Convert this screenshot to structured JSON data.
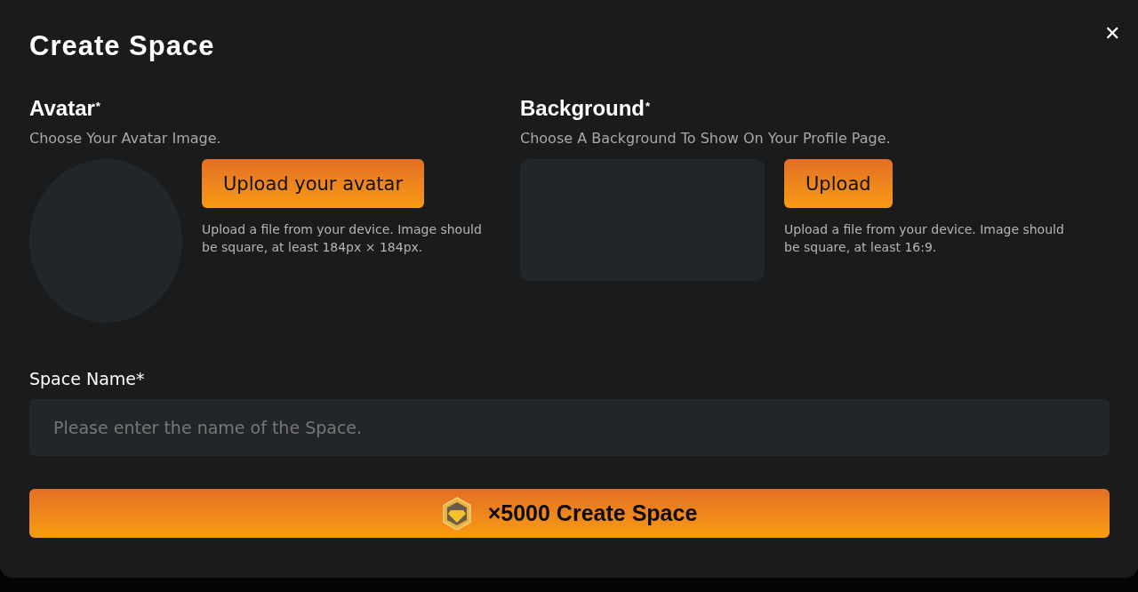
{
  "dialog": {
    "title": "Create Space",
    "close": "✕"
  },
  "uploads": [
    {
      "kind": "avatar",
      "label": "Avatar",
      "mark": "*",
      "hint": "Choose Your Avatar Image.",
      "button": "Upload your avatar",
      "note": "Upload a file from your device. Image should be square, at least 184px × 184px."
    },
    {
      "kind": "background",
      "label": "Background",
      "mark": "*",
      "hint": "Choose A Background To Show On Your Profile Page.",
      "button": "Upload",
      "note": "Upload a file from your device. Image should be square, at least 16:9."
    }
  ],
  "space_name": {
    "label": "Space Name*",
    "placeholder": "Please enter the name of the Space."
  },
  "submit": {
    "label": "×5000 Create Space"
  }
}
